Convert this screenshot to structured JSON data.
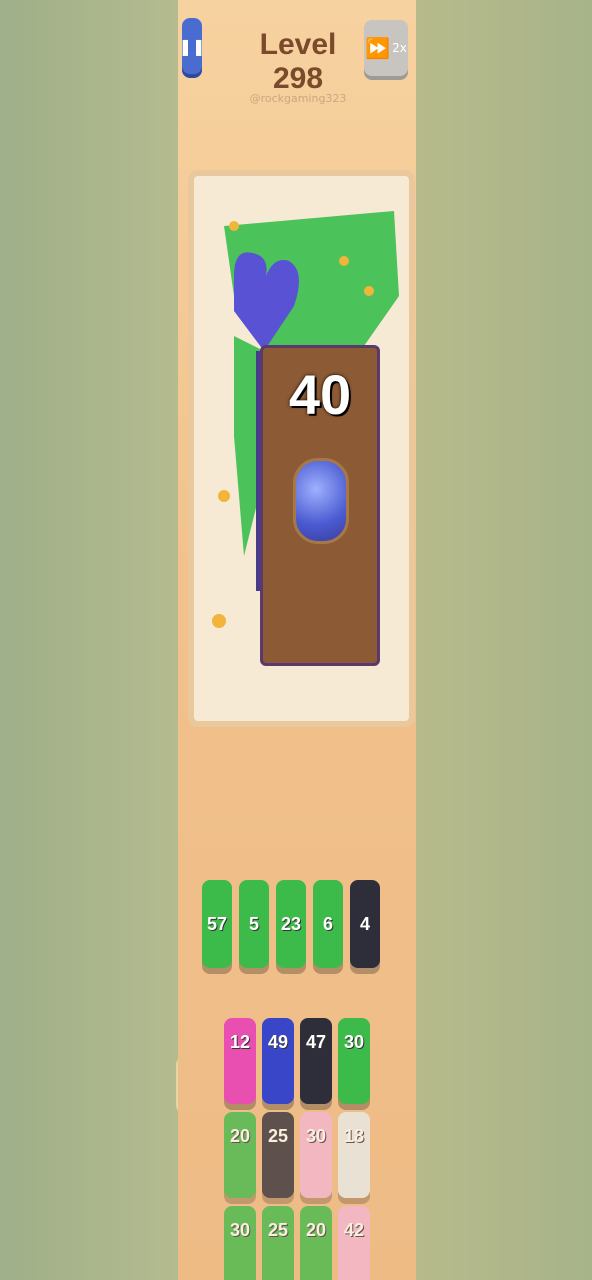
{
  "header": {
    "level_title": "Level 298",
    "watermark": "@rockgaming323",
    "speed_label": "2x"
  },
  "board": {
    "counter": "40"
  },
  "queue": [
    {
      "value": "57",
      "color": "#3dbb4a"
    },
    {
      "value": "5",
      "color": "#3dbb4a"
    },
    {
      "value": "23",
      "color": "#3dbb4a"
    },
    {
      "value": "6",
      "color": "#3dbb4a"
    },
    {
      "value": "4",
      "color": "#2e2e3a"
    }
  ],
  "grid": [
    {
      "value": "12",
      "color": "#e94fb0"
    },
    {
      "value": "49",
      "color": "#3a46c8"
    },
    {
      "value": "47",
      "color": "#2e2e3a"
    },
    {
      "value": "30",
      "color": "#3dbb4a"
    },
    {
      "value": "20",
      "color": "#3dbb4a"
    },
    {
      "value": "25",
      "color": "#2e2e3a"
    },
    {
      "value": "30",
      "color": "#f5b6d6"
    },
    {
      "value": "18",
      "color": "#e9eef0"
    },
    {
      "value": "30",
      "color": "#3dbb4a"
    },
    {
      "value": "25",
      "color": "#3dbb4a"
    },
    {
      "value": "20",
      "color": "#3dbb4a"
    },
    {
      "value": "42",
      "color": "#f5b6d6"
    }
  ],
  "icons": [
    "pause-icon",
    "fast-forward-icon"
  ]
}
